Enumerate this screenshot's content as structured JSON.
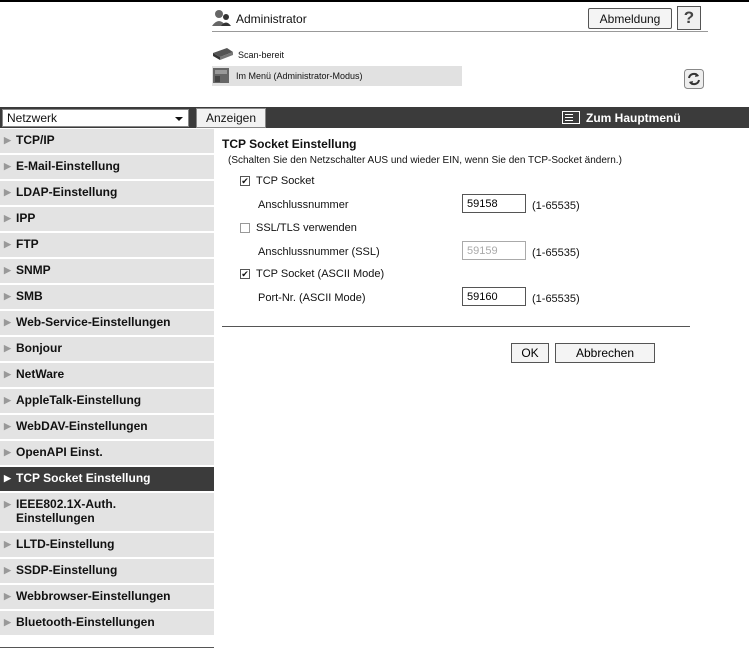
{
  "header": {
    "user_icon": "admin-user-icon",
    "user_label": "Administrator",
    "logout_label": "Abmeldung",
    "help_label": "?",
    "status": [
      {
        "icon": "scanner-icon",
        "text": "Scan-bereit"
      },
      {
        "icon": "printer-icon",
        "text": "Im Menü (Administrator-Modus)"
      }
    ],
    "refresh_icon": "refresh-icon"
  },
  "toolbar": {
    "category_value": "Netzwerk",
    "show_label": "Anzeigen",
    "main_menu_label": "Zum Hauptmenü",
    "main_menu_icon": "menu-list-icon"
  },
  "sidebar": {
    "items": [
      {
        "label": "TCP/IP"
      },
      {
        "label": "E-Mail-Einstellung"
      },
      {
        "label": "LDAP-Einstellung"
      },
      {
        "label": "IPP"
      },
      {
        "label": "FTP"
      },
      {
        "label": "SNMP"
      },
      {
        "label": "SMB"
      },
      {
        "label": "Web-Service-Einstellungen"
      },
      {
        "label": "Bonjour"
      },
      {
        "label": "NetWare"
      },
      {
        "label": "AppleTalk-Einstellung"
      },
      {
        "label": "WebDAV-Einstellungen"
      },
      {
        "label": "OpenAPI Einst."
      },
      {
        "label": "TCP Socket Einstellung",
        "active": true
      },
      {
        "label": "IEEE802.1X-Auth.\nEinstellungen"
      },
      {
        "label": "LLTD-Einstellung"
      },
      {
        "label": "SSDP-Einstellung"
      },
      {
        "label": "Webbrowser-Einstellungen"
      },
      {
        "label": "Bluetooth-Einstellungen"
      }
    ]
  },
  "main": {
    "title": "TCP Socket Einstellung",
    "note": "(Schalten Sie den Netzschalter AUS und wieder EIN, wenn Sie den TCP-Socket ändern.)",
    "tcp_socket": {
      "label": "TCP Socket",
      "checked": true
    },
    "port": {
      "label": "Anschlussnummer",
      "value": "59158",
      "range": "(1-65535)"
    },
    "ssl": {
      "label": "SSL/TLS verwenden",
      "checked": false
    },
    "port_ssl": {
      "label": "Anschlussnummer (SSL)",
      "value": "59159",
      "range": "(1-65535)"
    },
    "ascii": {
      "label": "TCP Socket (ASCII Mode)",
      "checked": true
    },
    "port_ascii": {
      "label": "Port-Nr. (ASCII Mode)",
      "value": "59160",
      "range": "(1-65535)"
    },
    "ok_label": "OK",
    "cancel_label": "Abbrechen"
  }
}
